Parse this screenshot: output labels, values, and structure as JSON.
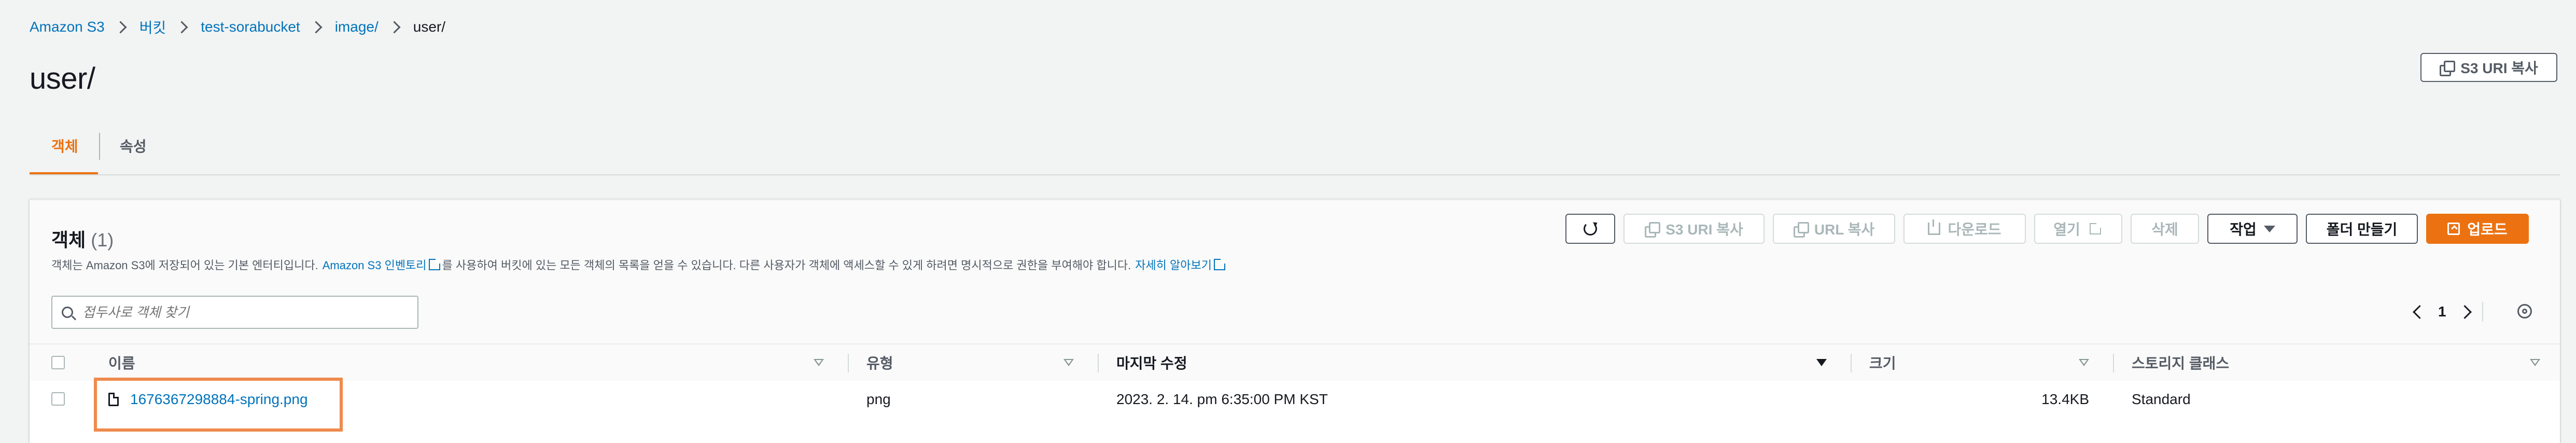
{
  "breadcrumb": [
    "Amazon S3",
    "버킷",
    "test-sorabucket",
    "image/",
    "user/"
  ],
  "page_title": "user/",
  "header_button": "S3 URI 복사",
  "tabs": [
    {
      "label": "객체",
      "active": true
    },
    {
      "label": "속성",
      "active": false
    }
  ],
  "panel": {
    "title": "객체",
    "count": "(1)",
    "desc_part1": "객체는 Amazon S3에 저장되어 있는 기본 엔터티입니다.",
    "desc_link1": "Amazon S3 인벤토리",
    "desc_part2": "를 사용하여 버킷에 있는 모든 객체의 목록을 얻을 수 있습니다. 다른 사용자가 객체에 액세스할 수 있게 하려면 명시적으로 권한을 부여해야 합니다.",
    "desc_link2": "자세히 알아보기",
    "search_placeholder": "접두사로 객체 찾기",
    "page_number": "1"
  },
  "toolbar": {
    "copy_s3_uri": "S3 URI 복사",
    "copy_url": "URL 복사",
    "download": "다운로드",
    "open": "열기",
    "delete": "삭제",
    "actions": "작업",
    "create_folder": "폴더 만들기",
    "upload": "업로드"
  },
  "table": {
    "columns": [
      "이름",
      "유형",
      "마지막 수정",
      "크기",
      "스토리지 클래스"
    ],
    "rows": [
      {
        "name": "1676367298884-spring.png",
        "type": "png",
        "last_modified": "2023. 2. 14. pm 6:35:00 PM KST",
        "size": "13.4KB",
        "storage_class": "Standard"
      }
    ]
  },
  "colors": {
    "accent": "#ec7211",
    "link": "#0073bb",
    "highlight_box": "#ef8a4c"
  }
}
